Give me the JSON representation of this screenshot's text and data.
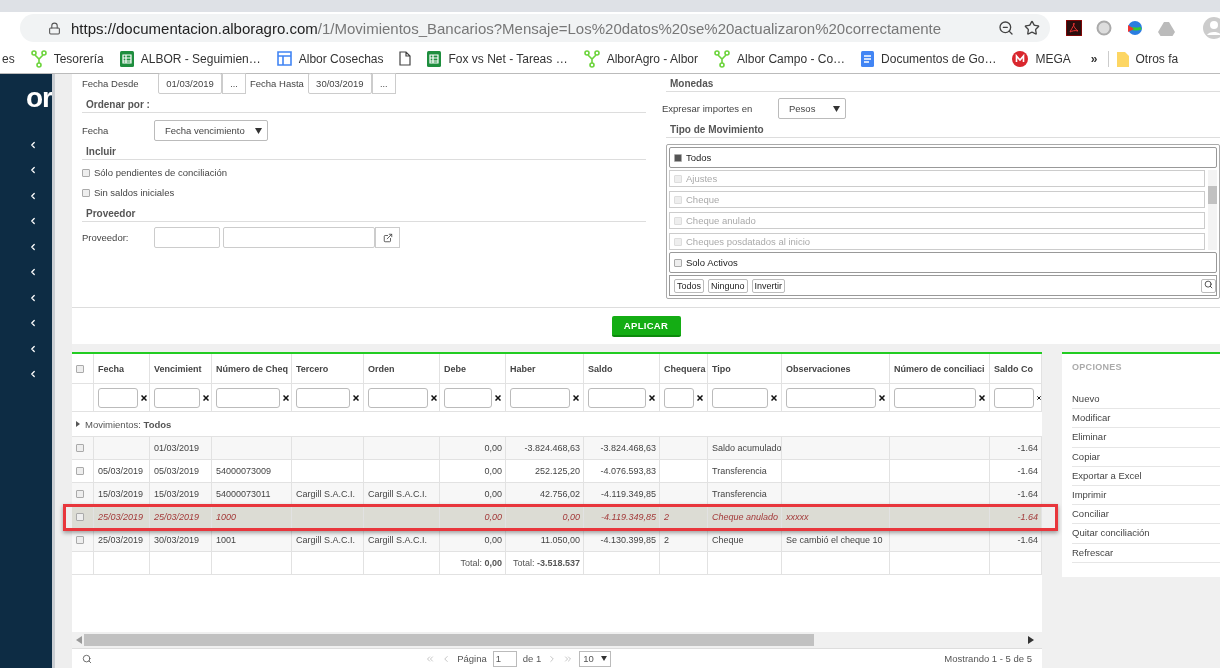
{
  "browser": {
    "url_host": "https://documentacion.alboragro.com",
    "url_path": "/1/Movimientos_Bancarios?Mensaje=Los%20datos%20se%20actualizaron%20correctamente",
    "bookmarks": [
      {
        "kind": "plain",
        "label": "es"
      },
      {
        "kind": "tree",
        "label": "Tesorería"
      },
      {
        "kind": "sheet",
        "label": "ALBOR - Seguimien…"
      },
      {
        "kind": "layout",
        "label": "Albor Cosechas"
      },
      {
        "kind": "page"
      },
      {
        "kind": "sheet",
        "label": "Fox vs Net - Tareas …"
      },
      {
        "kind": "tree",
        "label": "AlborAgro - Albor"
      },
      {
        "kind": "tree",
        "label": "Albor Campo - Co…"
      },
      {
        "kind": "docs",
        "label": "Documentos de Go…"
      },
      {
        "kind": "mega",
        "label": "MEGA"
      }
    ],
    "more": "»",
    "other_folder": "Otros fa"
  },
  "sidebar": {
    "logo": "or"
  },
  "form": {
    "fecha_desde": {
      "label": "Fecha Desde",
      "value": "01/03/2019",
      "button": "..."
    },
    "fecha_hasta": {
      "label": "Fecha Hasta",
      "value": "30/03/2019",
      "button": "..."
    },
    "ordenar": {
      "title": "Ordenar por :",
      "label": "Fecha",
      "value": "Fecha vencimiento"
    },
    "incluir": {
      "title": "Incluir",
      "options": [
        {
          "label": "Sólo pendientes de conciliación",
          "checked": false
        },
        {
          "label": "Sin saldos iniciales",
          "checked": false
        }
      ]
    },
    "proveedor": {
      "title": "Proveedor",
      "label": "Proveedor:"
    },
    "monedas": {
      "title": "Monedas",
      "label": "Expresar importes en",
      "value": "Pesos"
    },
    "tipo": {
      "title": "Tipo de Movimiento",
      "all": {
        "label": "Todos",
        "checked": true
      },
      "items": [
        {
          "label": "Ajustes",
          "checked": false,
          "disabled": true
        },
        {
          "label": "Cheque",
          "checked": false,
          "disabled": true
        },
        {
          "label": "Cheque anulado",
          "checked": false,
          "disabled": true
        },
        {
          "label": "Cheques posdatados al inicio",
          "checked": false,
          "disabled": true
        }
      ],
      "solo_activos": {
        "label": "Solo Activos",
        "checked": false
      },
      "buttons": [
        "Todos",
        "Ninguno",
        "Invertir"
      ]
    },
    "apply": "APLICAR"
  },
  "table": {
    "all_checked": false,
    "columns": [
      "Fecha",
      "Vencimient",
      "Número de Cheq",
      "Tercero",
      "Orden",
      "Debe",
      "Haber",
      "Saldo",
      "Chequera",
      "Tipo",
      "Observaciones",
      "Número de conciliaci",
      "Saldo Co"
    ],
    "group": "Movimientos: **Todos**",
    "rows": [
      {
        "selected": false,
        "kind": "normal",
        "checked": false,
        "vencimiento": "01/03/2019",
        "debe": "0,00",
        "haber": "-3.824.468,63",
        "saldo": "-3.824.468,63",
        "tipo": "Saldo acumulado",
        "saldo_co": "-1.64"
      },
      {
        "selected": false,
        "kind": "normal",
        "checked": false,
        "fecha": "05/03/2019",
        "vencimiento": "05/03/2019",
        "numero_cheque": "54000073009",
        "debe": "0,00",
        "haber": "252.125,20",
        "saldo": "-4.076.593,83",
        "tipo": "Transferencia",
        "saldo_co": "-1.64"
      },
      {
        "selected": false,
        "kind": "normal",
        "checked": false,
        "fecha": "15/03/2019",
        "vencimiento": "15/03/2019",
        "numero_cheque": "54000073011",
        "tercero": "Cargill S.A.C.I.",
        "orden": "Cargill S.A.C.I.",
        "debe": "0,00",
        "haber": "42.756,02",
        "saldo": "-4.119.349,85",
        "tipo": "Transferencia",
        "saldo_co": "-1.64"
      },
      {
        "selected": true,
        "kind": "void",
        "checked": false,
        "fecha": "25/03/2019",
        "vencimiento": "25/03/2019",
        "numero_cheque": "1000",
        "debe": "0,00",
        "haber": "0,00",
        "saldo": "-4.119.349,85",
        "chequera": "2",
        "tipo": "Cheque anulado",
        "observaciones": "xxxxx",
        "saldo_co": "-1.64"
      },
      {
        "selected": false,
        "kind": "normal",
        "checked": false,
        "fecha": "25/03/2019",
        "vencimiento": "30/03/2019",
        "numero_cheque": "1001",
        "tercero": "Cargill S.A.C.I.",
        "orden": "Cargill S.A.C.I.",
        "debe": "0,00",
        "haber": "11.050,00",
        "saldo": "-4.130.399,85",
        "chequera": "2",
        "tipo": "Cheque",
        "observaciones": "Se cambió el cheque 10",
        "saldo_co": "-1.64"
      }
    ],
    "totals": {
      "debe": "Total: **0,00**",
      "haber": "Total: **-3.518.537**"
    },
    "pager": {
      "page_label": "Página",
      "page": "1",
      "of": "de 1",
      "size": "10",
      "summary": "Mostrando 1 - 5 de 5"
    }
  },
  "options": {
    "title": "OPCIONES",
    "items": [
      "Nuevo",
      "Modificar",
      "Eliminar",
      "Copiar",
      "Exportar a Excel",
      "Imprimir",
      "Conciliar",
      "Quitar conciliación",
      "Refrescar"
    ]
  }
}
